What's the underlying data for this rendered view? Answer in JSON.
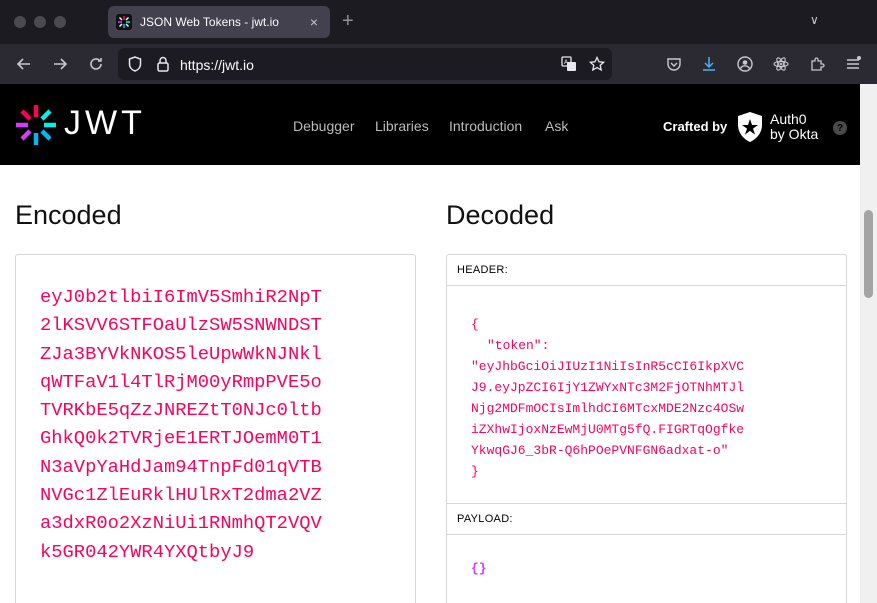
{
  "browser": {
    "tab_title": "JSON Web Tokens - jwt.io",
    "tab_close": "×",
    "new_tab": "+",
    "tab_list": "∨",
    "url": "https://jwt.io"
  },
  "site": {
    "logo_text": "JWT",
    "menu": [
      "Debugger",
      "Libraries",
      "Introduction",
      "Ask"
    ],
    "crafted_by": "Crafted by",
    "auth0_line1": "Auth0",
    "auth0_line2": "by Okta",
    "help": "?"
  },
  "encoded": {
    "title": "Encoded",
    "lines": [
      "eyJ0b2tlbiI6ImV5SmhiR2NpT",
      "2lKSVV6STFOaUlzSW5SNWNDST",
      "ZJa3BYVkNKOS5leUpwWkNJNkl",
      "qWTFaV1l4TlRjM00yRmpPVE5o",
      "TVRKbE5qZzJNREZtT0NJc0ltb",
      "GhkQ0k2TVRjeE1ERTJOemM0T1",
      "N3aVpYaHdJam94TnpFd01qVTB",
      "NVGc1ZlEuRklHUlRxT2dma2VZ",
      "a3dxR0o2XzNiUi1RNmhQT2VQV",
      "k5GR042YWR4YXQtbyJ9"
    ]
  },
  "decoded": {
    "title": "Decoded",
    "header_label": "HEADER:",
    "header_open": "{",
    "header_key": "\"token\":",
    "header_value_lines": [
      "\"eyJhbGciOiJIUzI1NiIsInR5cCI6IkpXVC",
      "J9.eyJpZCI6IjY1ZWYxNTc3M2FjOTNhMTJl",
      "Njg2MDFmOCIsImlhdCI6MTcxMDE2Nzc4OSw",
      "iZXhwIjoxNzEwMjU0MTg5fQ.FIGRTqOgfke",
      "YkwqGJ6_3bR-Q6hPOePVNFGN6adxat-o\""
    ],
    "header_close": "}",
    "payload_label": "PAYLOAD:",
    "payload_value": "{}"
  }
}
